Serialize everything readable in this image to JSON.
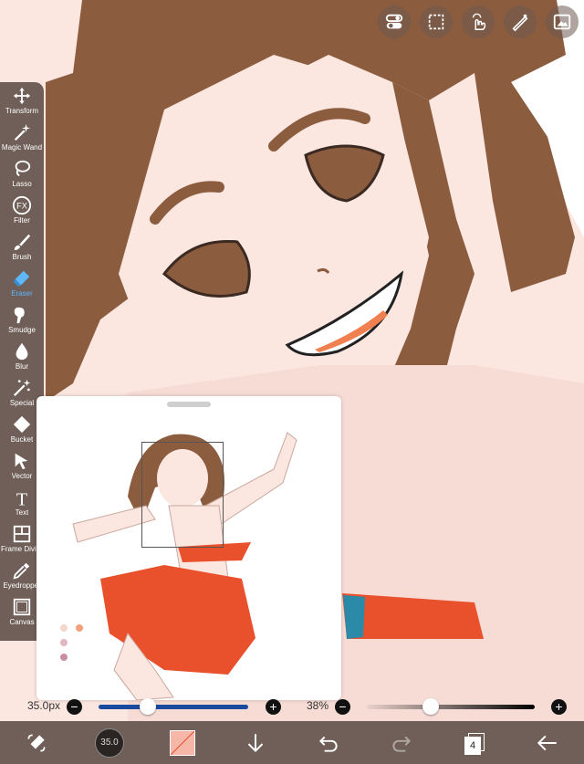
{
  "top_buttons": [
    {
      "icon": "toggle-icon"
    },
    {
      "icon": "selection-rect-icon"
    },
    {
      "icon": "touch-gesture-icon"
    },
    {
      "icon": "ruler-pen-icon"
    },
    {
      "icon": "reference-window-icon"
    }
  ],
  "toolbar": {
    "items": [
      {
        "label": "Transform",
        "icon": "transform-icon"
      },
      {
        "label": "Magic Wand",
        "icon": "magic-wand-icon"
      },
      {
        "label": "Lasso",
        "icon": "lasso-icon"
      },
      {
        "label": "Filter",
        "icon": "fx-icon"
      },
      {
        "label": "Brush",
        "icon": "brush-icon"
      },
      {
        "label": "Eraser",
        "icon": "eraser-icon",
        "active": true
      },
      {
        "label": "Smudge",
        "icon": "smudge-icon"
      },
      {
        "label": "Blur",
        "icon": "blur-drop-icon"
      },
      {
        "label": "Special",
        "icon": "special-icon"
      },
      {
        "label": "Bucket",
        "icon": "bucket-icon"
      },
      {
        "label": "Vector",
        "icon": "vector-cursor-icon"
      },
      {
        "label": "Text",
        "icon": "text-icon"
      },
      {
        "label": "Frame Divider",
        "icon": "frame-divider-icon"
      },
      {
        "label": "Eyedropper",
        "icon": "eyedropper-icon"
      },
      {
        "label": "Canvas",
        "icon": "canvas-icon"
      }
    ]
  },
  "sliders": {
    "size_label": "35.0px",
    "size_fraction": 0.33,
    "opacity_label": "38%",
    "opacity_fraction": 0.38
  },
  "bottombar": {
    "brush_size_value": "35.0",
    "layer_count": "4",
    "colors": {
      "primary": "#f6b7a8",
      "accent": "#5fb7ff"
    }
  },
  "colors": {
    "hair": "#8c5c3f",
    "skin": "#fbe6e0",
    "skirt": "#e9502c",
    "toolbar_bg": "#6f5f58"
  },
  "reference_palette": [
    "#f3d6cc",
    "#f4a07c",
    "#e3b7c2",
    "#c98ea8"
  ]
}
